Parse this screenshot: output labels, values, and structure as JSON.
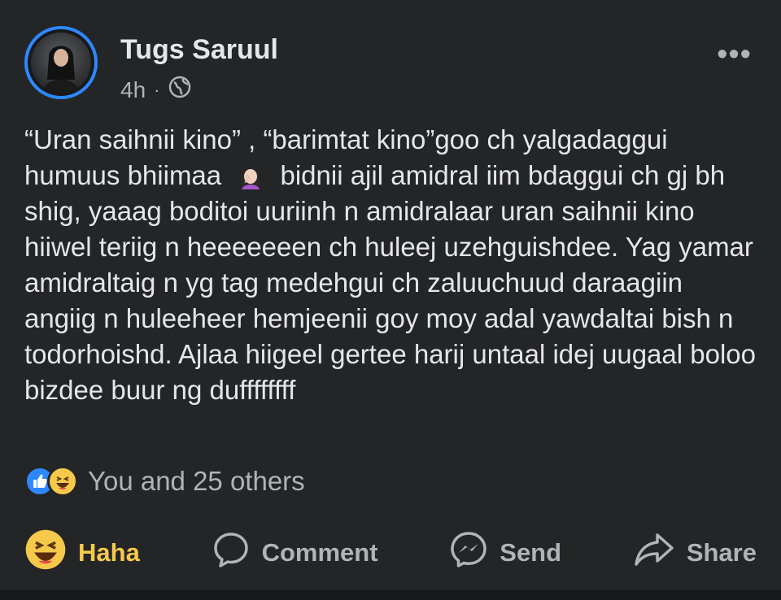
{
  "post": {
    "author": "Tugs Saruul",
    "time": "4h",
    "separator": "·",
    "privacy_icon": "globe-icon",
    "more_label": "•••",
    "text_line_1": "“Uran saihnii kino” , “barimtat kino”goo ch yalgadaggui humuus bhiimaa",
    "text_line_2": "bidnii ajil amidral iim bdaggui ch gj bh shig, yaaag boditoi uuriinh n amidralaar uran saihnii kino hiiwel teriig n heeeeeeen ch huleej uzehguishdee. Yag yamar amidraltaig n yg tag medehgui ch zaluuchuud daraagiin angiig n huleeheer hemjeenii goy moy adal yawdaltai bish n todorhoishd. Ajlaa hiigeel gertee harij untaal idej uugaal boloo bizdee buur ng duffffffff",
    "inline_emoji": "woman-facepalming-emoji"
  },
  "reactions": {
    "icons": [
      "like-icon",
      "haha-icon"
    ],
    "summary": "You and 25 others"
  },
  "actions": {
    "haha_label": "Haha",
    "comment_label": "Comment",
    "send_label": "Send",
    "share_label": "Share"
  },
  "colors": {
    "background": "#242526",
    "text": "#e4e6eb",
    "muted": "#b0b3b8",
    "accent_blue": "#2d88ff",
    "haha_yellow": "#f7c94b"
  }
}
